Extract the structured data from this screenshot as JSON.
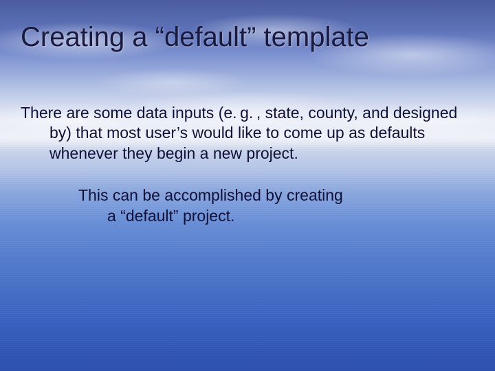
{
  "title": "Creating a “default” template",
  "paragraph1": "There are some data inputs (e. g. , state, county, and designed by) that most user’s would like to come up as defaults whenever they begin a new project.",
  "paragraph2_line1": "This can be accomplished by creating",
  "paragraph2_line2": "a “default” project."
}
